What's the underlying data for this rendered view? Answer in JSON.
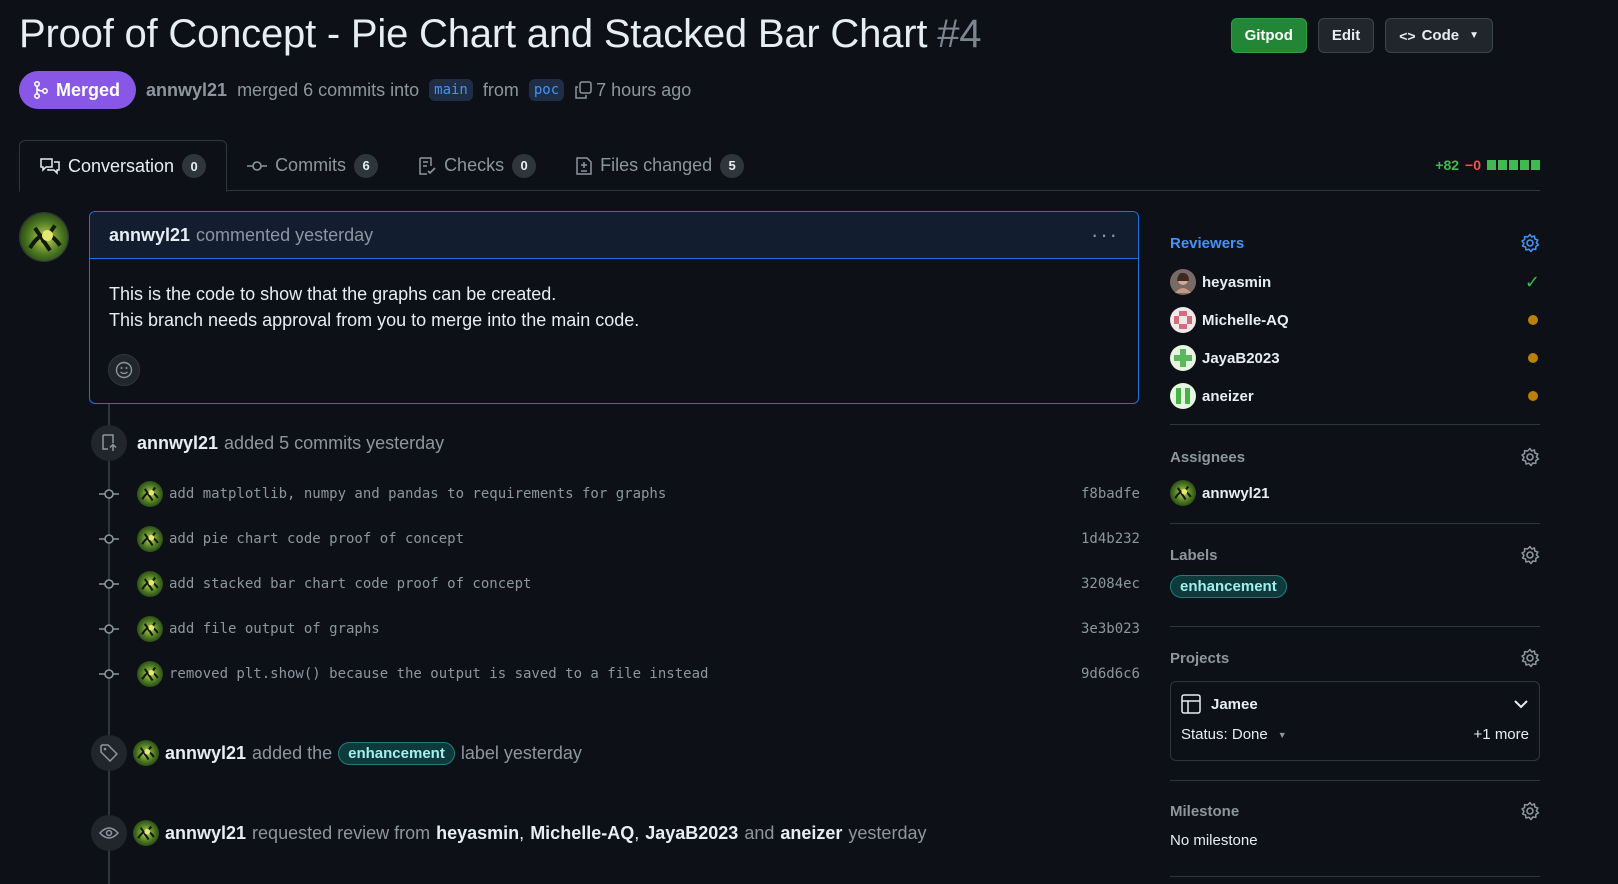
{
  "pr": {
    "title": "Proof of Concept - Pie Chart and Stacked Bar Chart",
    "number": "#4",
    "state": "Merged",
    "author": "annwyl21",
    "merged_text": "merged 6 commits into",
    "base_branch": "main",
    "from_text": "from",
    "head_branch": "poc",
    "time": "7 hours ago"
  },
  "header_buttons": {
    "gitpod": "Gitpod",
    "edit": "Edit",
    "code": "Code"
  },
  "tabs": [
    {
      "label": "Conversation",
      "count": "0"
    },
    {
      "label": "Commits",
      "count": "6"
    },
    {
      "label": "Checks",
      "count": "0"
    },
    {
      "label": "Files changed",
      "count": "5"
    }
  ],
  "diffstat": {
    "additions": "+82",
    "deletions": "−0"
  },
  "comment": {
    "author": "annwyl21",
    "meta": "commented yesterday",
    "line1": "This is the code to show that the graphs can be created.",
    "line2": "This branch needs approval from you to merge into the main code."
  },
  "commits_event": {
    "author": "annwyl21",
    "text": "added 5 commits yesterday"
  },
  "commits": [
    {
      "message": "add matplotlib, numpy and pandas to requirements for graphs",
      "sha": "f8badfe"
    },
    {
      "message": "add pie chart code proof of concept",
      "sha": "1d4b232"
    },
    {
      "message": "add stacked bar chart code proof of concept",
      "sha": "32084ec"
    },
    {
      "message": "add file output of graphs",
      "sha": "3e3b023"
    },
    {
      "message": "removed plt.show() because the output is saved to a file instead",
      "sha": "9d6d6c6"
    }
  ],
  "label_event": {
    "author": "annwyl21",
    "pre": "added the",
    "label": "enhancement",
    "post": "label yesterday"
  },
  "review_event": {
    "author": "annwyl21",
    "pre": "requested review from",
    "r1": "heyasmin",
    "comma1": ",",
    "r2": "Michelle-AQ",
    "comma2": ",",
    "r3": "JayaB2023",
    "and": "and",
    "r4": "aneizer",
    "post": "yesterday"
  },
  "sidebar": {
    "reviewers_title": "Reviewers",
    "reviewers": [
      "heyasmin",
      "Michelle-AQ",
      "JayaB2023",
      "aneizer"
    ],
    "assignees_title": "Assignees",
    "assignee": "annwyl21",
    "labels_title": "Labels",
    "label": "enhancement",
    "projects_title": "Projects",
    "project_name": "Jamee",
    "project_status": "Status: Done",
    "project_more": "+1 more",
    "milestone_title": "Milestone",
    "milestone_value": "No milestone"
  },
  "colors": {
    "merged": "#8957e5",
    "green": "#238636",
    "link": "#4493f8",
    "pending": "#bb8009"
  }
}
